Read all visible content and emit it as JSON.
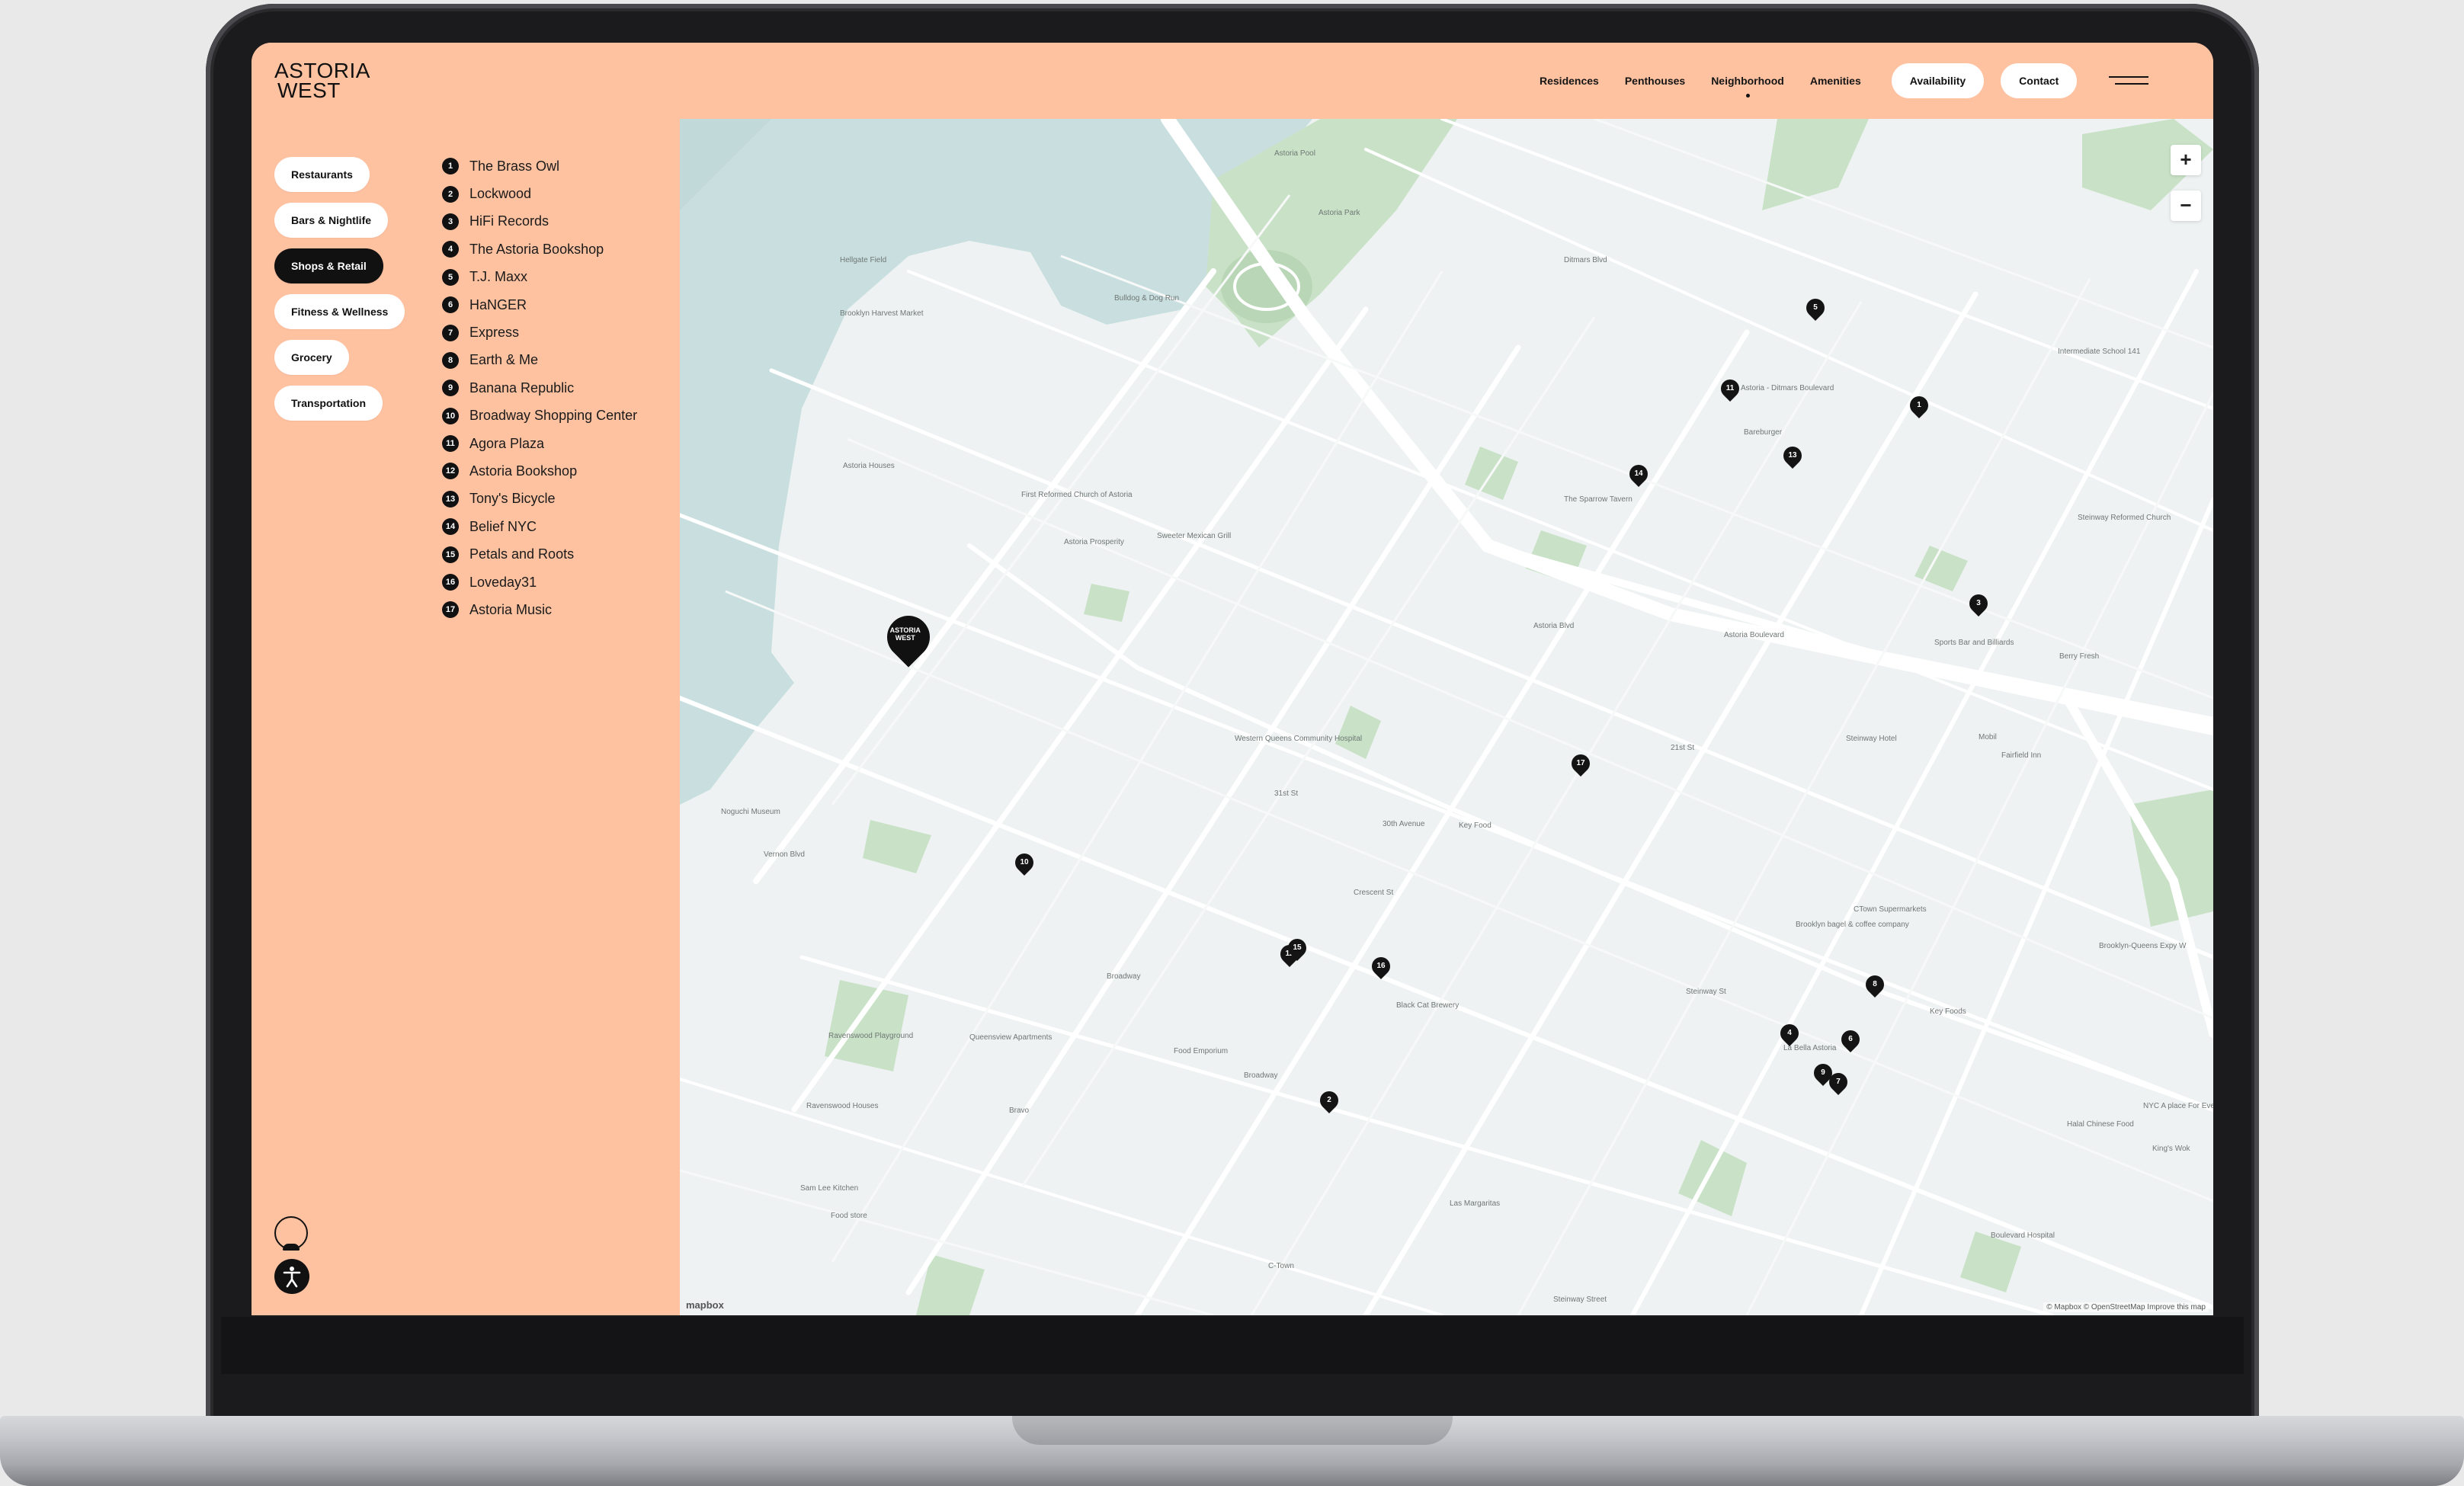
{
  "brand": {
    "line1": "ASTORIA",
    "line2": "WEST"
  },
  "nav": {
    "items": [
      "Residences",
      "Penthouses",
      "Neighborhood",
      "Amenities"
    ],
    "active": "Neighborhood",
    "availability_label": "Availability",
    "contact_label": "Contact"
  },
  "categories": [
    {
      "label": "Restaurants",
      "active": false
    },
    {
      "label": "Bars & Nightlife",
      "active": false
    },
    {
      "label": "Shops & Retail",
      "active": true
    },
    {
      "label": "Fitness & Wellness",
      "active": false
    },
    {
      "label": "Grocery",
      "active": false
    },
    {
      "label": "Transportation",
      "active": false
    }
  ],
  "places": [
    {
      "num": "1",
      "name": "The Brass Owl"
    },
    {
      "num": "2",
      "name": "Lockwood"
    },
    {
      "num": "3",
      "name": "HiFi Records"
    },
    {
      "num": "4",
      "name": "The Astoria Bookshop"
    },
    {
      "num": "5",
      "name": "T.J. Maxx"
    },
    {
      "num": "6",
      "name": "HaNGER"
    },
    {
      "num": "7",
      "name": "Express"
    },
    {
      "num": "8",
      "name": "Earth & Me"
    },
    {
      "num": "9",
      "name": "Banana Republic"
    },
    {
      "num": "10",
      "name": "Broadway Shopping Center"
    },
    {
      "num": "11",
      "name": "Agora Plaza"
    },
    {
      "num": "12",
      "name": "Astoria Bookshop"
    },
    {
      "num": "13",
      "name": "Tony's Bicycle"
    },
    {
      "num": "14",
      "name": "Belief NYC"
    },
    {
      "num": "15",
      "name": "Petals and Roots"
    },
    {
      "num": "16",
      "name": "Loveday31"
    },
    {
      "num": "17",
      "name": "Astoria Music"
    }
  ],
  "map": {
    "zoom_in": "+",
    "zoom_out": "−",
    "home_marker": "ASTORIA WEST",
    "attribution": "© Mapbox © OpenStreetMap Improve this map",
    "mapbox_logo": "mapbox",
    "markers": [
      "1",
      "2",
      "3",
      "4",
      "5",
      "6",
      "7",
      "8",
      "9",
      "10",
      "11",
      "12",
      "13",
      "14",
      "15",
      "16",
      "17"
    ],
    "labels": [
      "Astoria Park",
      "Hellgate Field",
      "Astoria Pool",
      "Bulldog & Dog Run",
      "Brooklyn Harvest Market",
      "Astoria Houses",
      "First Reformed Church of Astoria",
      "Astoria Prosperity",
      "Sweeter Mexican Grill",
      "Astoria - Ditmars Boulevard",
      "Bareburger",
      "The Sparrow Tavern",
      "Intermediate School 141",
      "Astoria Boulevard",
      "Sports Bar and Billiards",
      "Steinway Reformed Church",
      "Berry Fresh",
      "Western Queens Community Hospital",
      "30th Avenue",
      "Key Food",
      "Steinway Hotel",
      "Mobil",
      "Fairfield Inn",
      "Noguchi Museum",
      "Ravenswood Playground",
      "Queensview Apartments",
      "Food Emporium",
      "Broadway",
      "Black Cat Brewery",
      "La Bella Astoria",
      "Brooklyn bagel & coffee company",
      "CTown Supermarkets",
      "Key Foods",
      "Halal Chinese Food",
      "King's Wok",
      "Boulevard Hospital",
      "Las Margaritas",
      "Steinway Street",
      "C-Town",
      "Ravenswood Houses",
      "Bravo",
      "Sam Lee Kitchen",
      "Food store",
      "Astoria Blvd",
      "31st St",
      "Crescent St",
      "Broadway",
      "Vernon Blvd",
      "Ditmars Blvd",
      "21st St",
      "Steinway St",
      "Brooklyn-Queens Expy W",
      "NYC A place For Everyone"
    ]
  },
  "colors": {
    "accent": "#ffc2a1",
    "active": "#111111",
    "water": "#c9dfdf",
    "park": "#c9e2c7",
    "map_bg": "#eef2f2"
  }
}
